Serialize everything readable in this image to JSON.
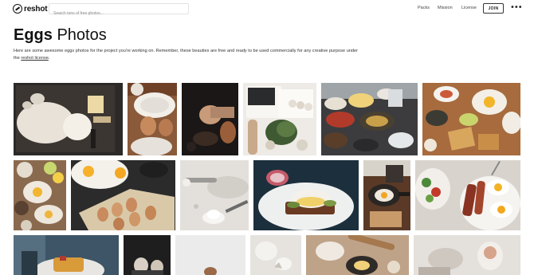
{
  "brand": {
    "name": "reshot"
  },
  "search": {
    "placeholder": "Search tons of free photos..."
  },
  "nav": {
    "packs": "Packs",
    "mission": "Mission",
    "license": "License",
    "join": "JOIN",
    "more": "•••"
  },
  "page": {
    "title_bold": "Eggs",
    "title_rest": "Photos",
    "description_line": "Here are some awesome eggs photos for the project you're working on. Remember, these beauties are free and ready to be used commercially for any creative purpose under the",
    "license_link": "reshot license",
    "description_end": "."
  },
  "photos": [
    {
      "name": "photo-flour-eggs-dough"
    },
    {
      "name": "photo-eggs-bowl-flour"
    },
    {
      "name": "photo-cracking-egg-pan"
    },
    {
      "name": "photo-cookbook-eggs-herbs"
    },
    {
      "name": "photo-kitchen-cooking-bowls"
    },
    {
      "name": "photo-breakfast-table-toast"
    },
    {
      "name": "photo-breakfast-spread"
    },
    {
      "name": "photo-fried-eggs-carton"
    },
    {
      "name": "photo-flour-rolling-pin"
    },
    {
      "name": "photo-eggs-benedict-toast"
    },
    {
      "name": "photo-skillet-egg"
    },
    {
      "name": "photo-eggs-bacon-salad"
    },
    {
      "name": "photo-waffles-plate"
    },
    {
      "name": "photo-egg-cups-dark"
    },
    {
      "name": "photo-egg-on-white"
    },
    {
      "name": "photo-cracked-egg-shell"
    },
    {
      "name": "photo-bread-dough-eggs"
    },
    {
      "name": "photo-pan-cooking"
    },
    {
      "name": "photo-bright-breakfast"
    }
  ]
}
